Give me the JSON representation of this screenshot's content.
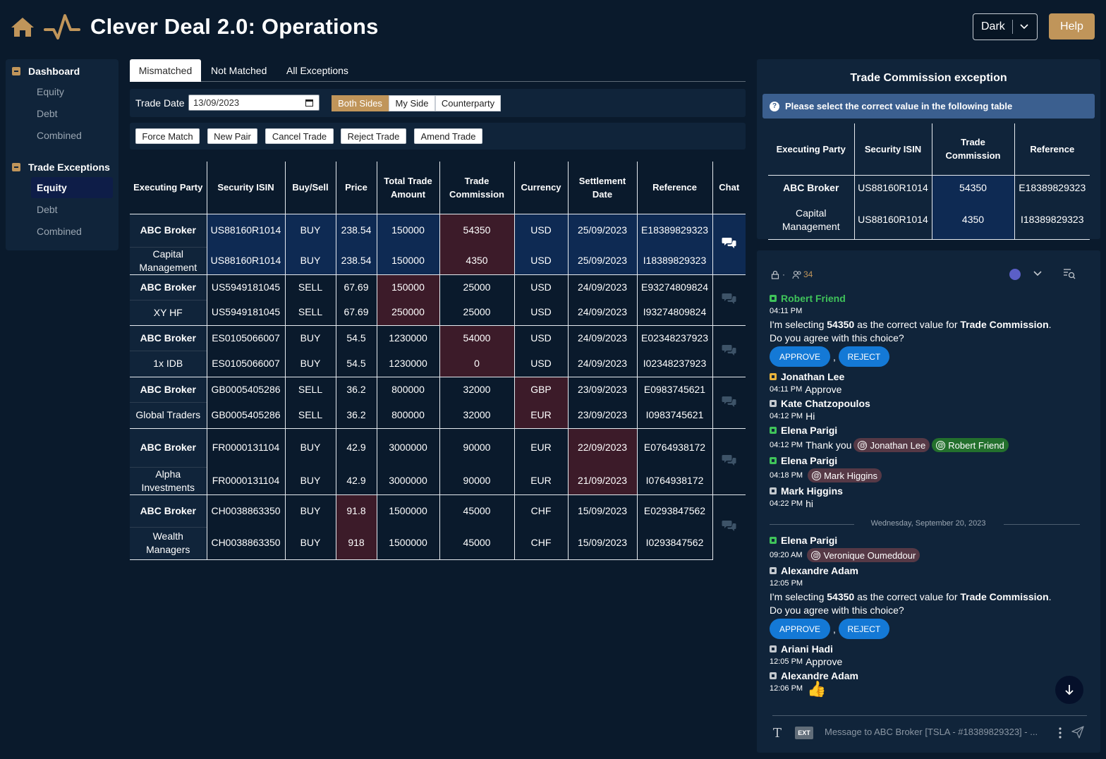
{
  "header": {
    "title": "Clever Deal 2.0: Operations",
    "theme_value": "Dark",
    "help_label": "Help",
    "icons": [
      "home-icon",
      "pulse-icon",
      "chevron-down-icon"
    ]
  },
  "sidebar": {
    "groups": [
      {
        "label": "Dashboard",
        "items": [
          "Equity",
          "Debt",
          "Combined"
        ]
      },
      {
        "label": "Trade Exceptions",
        "items": [
          "Equity",
          "Debt",
          "Combined"
        ],
        "active_item": "Equity"
      }
    ]
  },
  "tabs": [
    "Mismatched",
    "Not Matched",
    "All Exceptions"
  ],
  "active_tab": "Mismatched",
  "filters": {
    "trade_date_label": "Trade Date",
    "trade_date_value": "13/09/2023",
    "sides": [
      "Both Sides",
      "My Side",
      "Counterparty"
    ],
    "active_side": "Both Sides"
  },
  "actions": [
    "Force Match",
    "New Pair",
    "Cancel Trade",
    "Reject Trade",
    "Amend Trade"
  ],
  "table": {
    "columns": [
      "Executing Party",
      "Security ISIN",
      "Buy/Sell",
      "Price",
      "Total Trade Amount",
      "Trade Commission",
      "Currency",
      "Settlement Date",
      "Reference",
      "Chat"
    ],
    "pairs": [
      {
        "rows": [
          [
            "ABC Broker",
            "US88160R1014",
            "BUY",
            "238.54",
            "150000",
            "54350",
            "USD",
            "25/09/2023",
            "E18389829323"
          ],
          [
            "Capital Management",
            "US88160R1014",
            "BUY",
            "238.54",
            "150000",
            "4350",
            "USD",
            "25/09/2023",
            "I18389829323"
          ]
        ],
        "mismatch_column": "Trade Commission",
        "selected": true
      },
      {
        "rows": [
          [
            "ABC Broker",
            "US5949181045",
            "SELL",
            "67.69",
            "150000",
            "25000",
            "USD",
            "24/09/2023",
            "E93274809824"
          ],
          [
            "XY HF",
            "US5949181045",
            "SELL",
            "67.69",
            "250000",
            "25000",
            "USD",
            "24/09/2023",
            "I93274809824"
          ]
        ],
        "mismatch_column": "Total Trade Amount",
        "selected": false
      },
      {
        "rows": [
          [
            "ABC Broker",
            "ES0105066007",
            "BUY",
            "54.5",
            "1230000",
            "54000",
            "USD",
            "24/09/2023",
            "E02348237923"
          ],
          [
            "1x IDB",
            "ES0105066007",
            "BUY",
            "54.5",
            "1230000",
            "0",
            "USD",
            "24/09/2023",
            "I02348237923"
          ]
        ],
        "mismatch_column": "Trade Commission",
        "selected": false
      },
      {
        "rows": [
          [
            "ABC Broker",
            "GB0005405286",
            "SELL",
            "36.2",
            "800000",
            "32000",
            "GBP",
            "23/09/2023",
            "E0983745621"
          ],
          [
            "Global Traders",
            "GB0005405286",
            "SELL",
            "36.2",
            "800000",
            "32000",
            "EUR",
            "23/09/2023",
            "I0983745621"
          ]
        ],
        "mismatch_column": "Currency",
        "selected": false
      },
      {
        "rows": [
          [
            "ABC Broker",
            "FR0000131104",
            "BUY",
            "42.9",
            "3000000",
            "90000",
            "EUR",
            "22/09/2023",
            "E0764938172"
          ],
          [
            "Alpha Investments",
            "FR0000131104",
            "BUY",
            "42.9",
            "3000000",
            "90000",
            "EUR",
            "21/09/2023",
            "I0764938172"
          ]
        ],
        "mismatch_column": "Settlement Date",
        "selected": false
      },
      {
        "rows": [
          [
            "ABC Broker",
            "CH0038863350",
            "BUY",
            "91.8",
            "1500000",
            "45000",
            "CHF",
            "15/09/2023",
            "E0293847562"
          ],
          [
            "Wealth Managers",
            "CH0038863350",
            "BUY",
            "918",
            "1500000",
            "45000",
            "CHF",
            "15/09/2023",
            "I0293847562"
          ]
        ],
        "mismatch_column": "Price",
        "selected": false
      }
    ]
  },
  "exception_panel": {
    "title": "Trade Commission exception",
    "info": "Please select the correct value in the following table",
    "columns": [
      "Executing Party",
      "Security ISIN",
      "Trade Commission",
      "Reference"
    ],
    "rows": [
      [
        "ABC Broker",
        "US88160R1014",
        "54350",
        "E18389829323"
      ],
      [
        "Capital Management",
        "US88160R1014",
        "4350",
        "I18389829323"
      ]
    ]
  },
  "chat": {
    "member_count": "34",
    "messages": [
      {
        "author": "Robert Friend",
        "status": "green",
        "time": "04:11 PM",
        "text": "",
        "cut_off": true
      },
      {
        "proposal": true,
        "text_before": "I'm selecting ",
        "value": "54350",
        "text_mid": " as the correct value for ",
        "field": "Trade Commission",
        "text_after": ".",
        "question": "Do you agree with this choice?",
        "approve": "APPROVE",
        "reject": "REJECT"
      },
      {
        "author": "Jonathan Lee",
        "status": "yellow",
        "time": "04:11 PM",
        "text": "Approve"
      },
      {
        "author": "Kate Chatzopoulos",
        "status": "gray",
        "time": "04:12 PM",
        "text": "Hi"
      },
      {
        "author": "Elena Parigi",
        "status": "green",
        "time": "04:12 PM",
        "text": "Thank you",
        "mentions": [
          {
            "name": "Jonathan Lee",
            "color": "red"
          },
          {
            "name": "Robert Friend",
            "color": "green"
          }
        ]
      },
      {
        "author": "Elena Parigi",
        "status": "green",
        "time": "04:18 PM",
        "text": "",
        "mentions": [
          {
            "name": "Mark Higgins",
            "color": "red"
          }
        ]
      },
      {
        "author": "Mark Higgins",
        "status": "gray",
        "time": "04:22 PM",
        "text": "hi"
      }
    ],
    "day_separator": "Wednesday, September 20, 2023",
    "messages2": [
      {
        "author": "Elena Parigi",
        "status": "green",
        "time": "09:20 AM",
        "mention": "Veronique Oumeddour"
      },
      {
        "author": "Alexandre Adam",
        "status": "gray",
        "time": "12:05 PM"
      },
      {
        "author": "Ariani Hadi",
        "status": "gray",
        "time": "12:05 PM",
        "text": "Approve"
      },
      {
        "author": "Alexandre Adam",
        "status": "gray",
        "time": "12:06 PM",
        "emoji": "👍"
      }
    ],
    "input_placeholder": "Message to ABC Broker [TSLA - #18389829323] - ...",
    "ext_badge": "EXT",
    "text_format_glyph": "T"
  },
  "colors": {
    "accent": "#c0955a",
    "background": "#0a1a2c",
    "panel": "#10243a",
    "mismatch": "#3c1b29",
    "selected": "#0e2a53",
    "button_blue": "#1479d6"
  }
}
